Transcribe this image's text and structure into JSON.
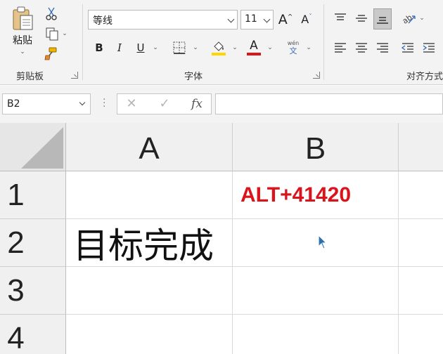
{
  "clipboard": {
    "paste_label": "粘贴",
    "group_label": "剪贴板"
  },
  "font": {
    "family": "等线",
    "size": "11",
    "group_label": "字体",
    "phonetic_label": "wén",
    "phonetic_char": "文",
    "font_color": "#d9141b",
    "highlight_color": "#ffd600"
  },
  "alignment": {
    "group_label": "对齐方式"
  },
  "formula_bar": {
    "name_box": "B2",
    "fx_label": "fx",
    "formula": ""
  },
  "sheet": {
    "columns": [
      "A",
      "B"
    ],
    "rows": [
      "1",
      "2",
      "3",
      "4"
    ],
    "cells": {
      "B1": "ALT+41420",
      "A2": "目标完成"
    },
    "cell_b1_color": "#d9141b"
  }
}
